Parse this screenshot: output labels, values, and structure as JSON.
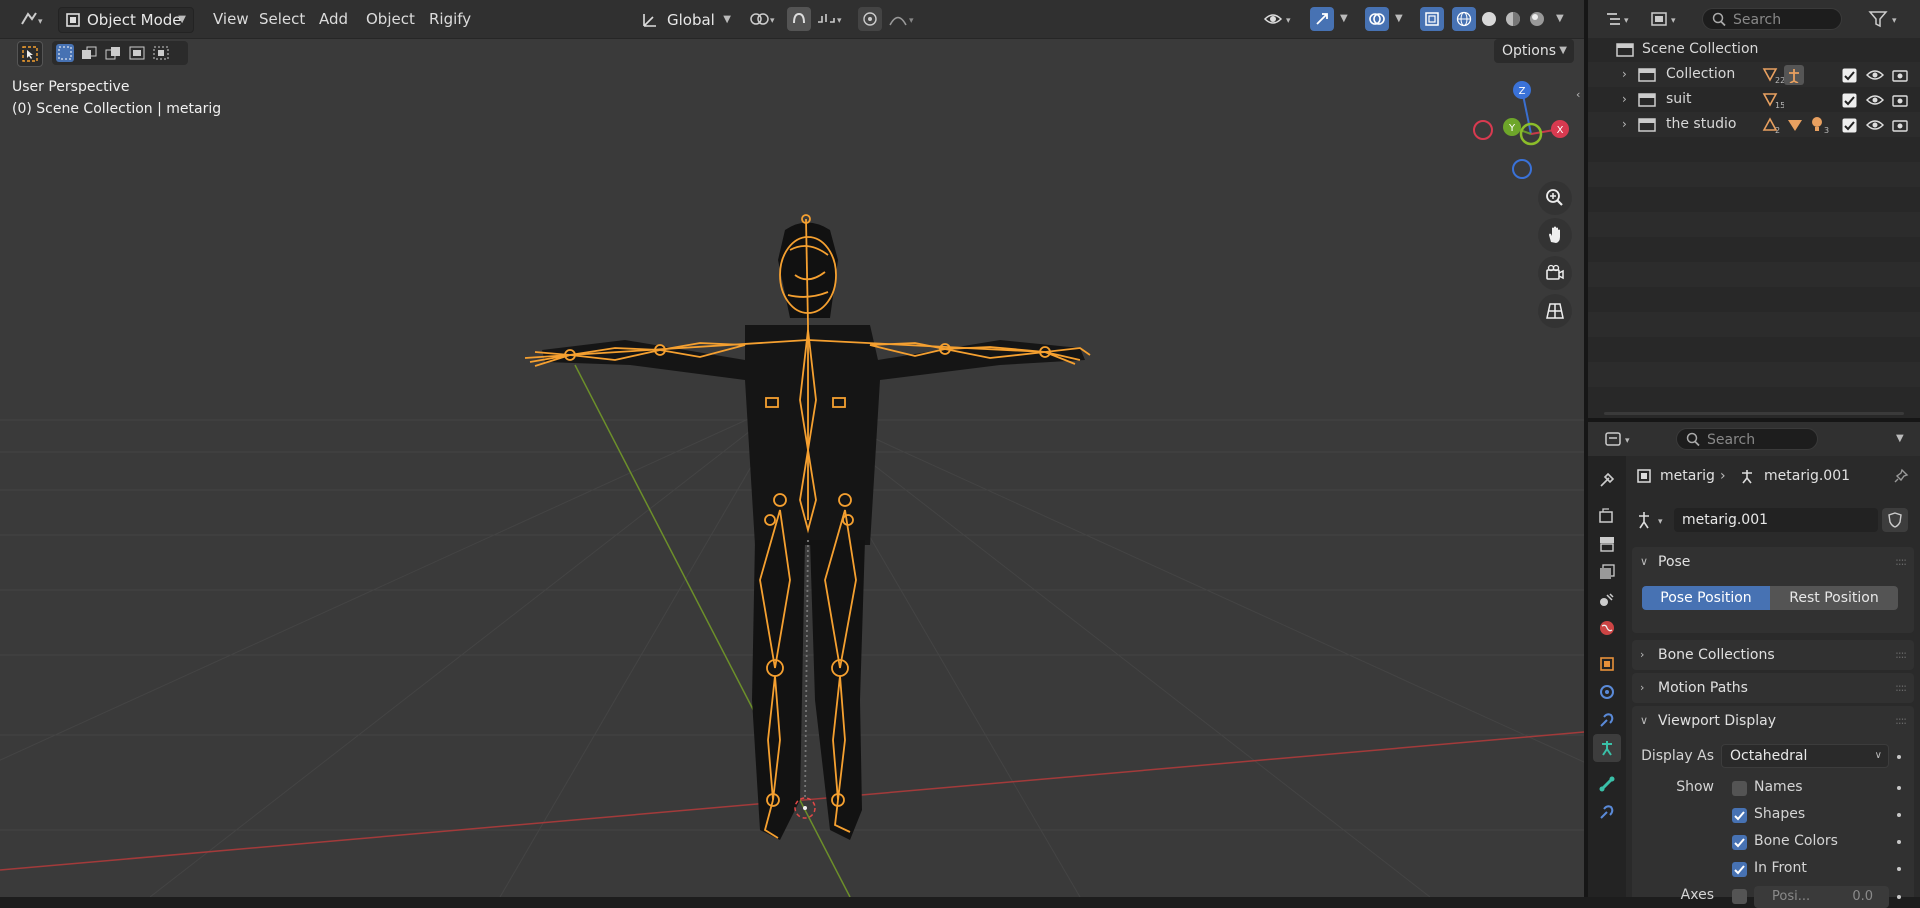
{
  "header": {
    "mode": "Object Mode",
    "menus": [
      "View",
      "Select",
      "Add",
      "Object",
      "Rigify"
    ],
    "orientation": "Global",
    "options": "Options"
  },
  "overlay": {
    "perspective": "User Perspective",
    "context": "(0) Scene Collection | metarig"
  },
  "gizmo": {
    "z": "Z",
    "y": "Y",
    "x": "X"
  },
  "outliner": {
    "search_placeholder": "Search",
    "root": "Scene Collection",
    "items": [
      {
        "name": "Collection",
        "badge": "22"
      },
      {
        "name": "suit",
        "badge": "15"
      },
      {
        "name": "the studio",
        "badge1": "2",
        "badge2": "3"
      }
    ]
  },
  "properties": {
    "search_placeholder": "Search",
    "breadcrumb": {
      "object": "metarig",
      "data": "metarig.001"
    },
    "datablock": "metarig.001",
    "panels": {
      "pose": "Pose",
      "bone_collections": "Bone Collections",
      "motion_paths": "Motion Paths",
      "viewport_display": "Viewport Display"
    },
    "pose_position": "Pose Position",
    "rest_position": "Rest Position",
    "display_as_label": "Display As",
    "display_as_value": "Octahedral",
    "show_label": "Show",
    "show_options": [
      {
        "label": "Names",
        "checked": false
      },
      {
        "label": "Shapes",
        "checked": true
      },
      {
        "label": "Bone Colors",
        "checked": true
      },
      {
        "label": "In Front",
        "checked": true
      }
    ],
    "axes_label": "Axes",
    "axes_position": "Posi...",
    "axes_value": "0.0"
  },
  "colors": {
    "accent": "#4772b3",
    "bone": "#f5a030",
    "grid_x": "#b33a3a",
    "grid_y": "#6f9a2a"
  }
}
